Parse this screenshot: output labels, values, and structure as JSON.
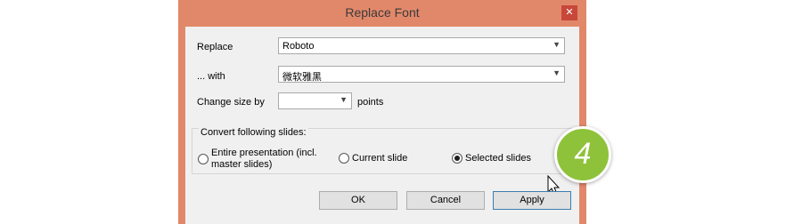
{
  "dialog": {
    "title": "Replace Font",
    "close_glyph": "✕"
  },
  "fields": {
    "replace_label": "Replace",
    "replace_value": "Roboto",
    "with_label": "... with",
    "with_value": "微软雅黑",
    "size_label": "Change size by",
    "size_value": "",
    "size_unit": "points"
  },
  "convert": {
    "title": "Convert following slides:",
    "options": [
      {
        "label_line1": "Entire presentation (incl.",
        "label_line2": "master slides)",
        "selected": false
      },
      {
        "label": "Current slide",
        "selected": false
      },
      {
        "label": "Selected slides",
        "selected": true
      }
    ]
  },
  "buttons": {
    "ok": "OK",
    "cancel": "Cancel",
    "apply": "Apply"
  },
  "badge": {
    "number": "4",
    "color": "#8fc23b"
  },
  "icons": {
    "dropdown": "chevron-down-icon",
    "cursor": "mouse-pointer-icon"
  },
  "colors": {
    "window_border": "#e2886a",
    "close_button": "#c8473b",
    "default_button_border": "#3c7fb1"
  }
}
